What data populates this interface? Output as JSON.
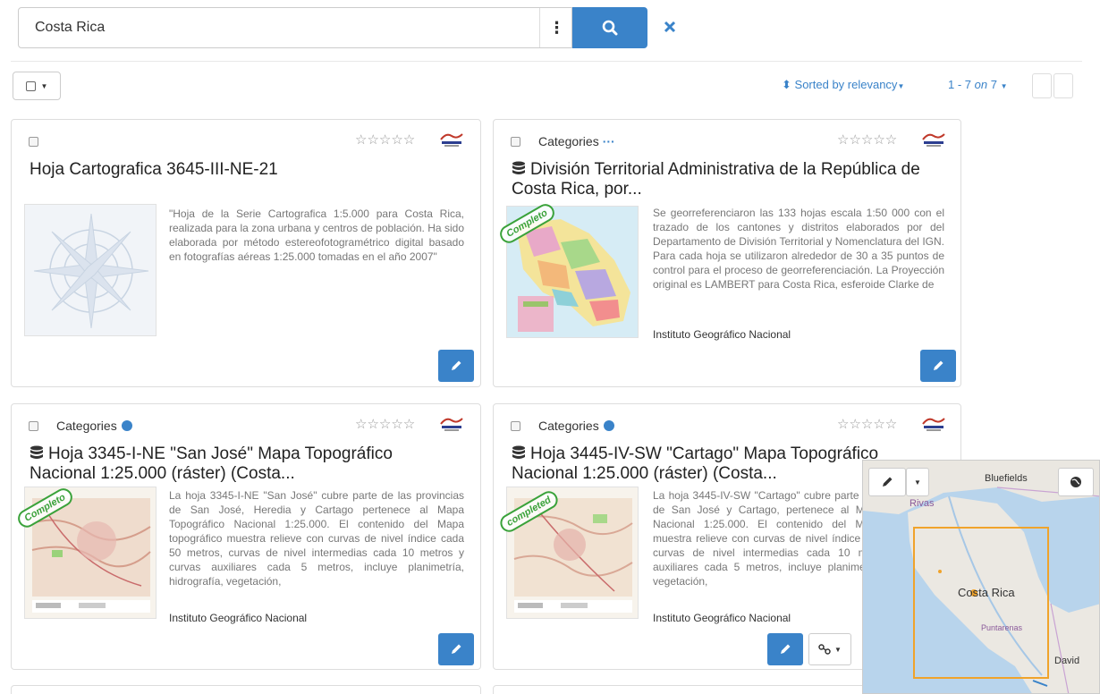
{
  "search": {
    "value": "Costa Rica",
    "options_icon": "⋮"
  },
  "toolbar": {
    "sort_label": "Sorted by relevancy",
    "paging_range": "1 - 7",
    "paging_on": "on",
    "paging_total": "7"
  },
  "cards": [
    {
      "title": "Hoja Cartografica 3645-III-NE-21",
      "category": "",
      "description": "\"Hoja de la Serie Cartografica 1:5.000 para Costa Rica, realizada para la zona urbana y centros de población. Ha sido elaborada por método estereofotogramétrico digital basado en fotografías aéreas 1:25.000 tomadas en el año 2007\"",
      "organization": "",
      "badge": ""
    },
    {
      "title": "División Territorial Administrativa de la República de Costa Rica, por...",
      "category": "Categories",
      "description": "Se georreferenciaron las 133 hojas escala 1:50 000 con el trazado de los cantones y distritos elaborados por del Departamento de División Territorial y Nomenclatura del IGN. Para cada hoja se utilizaron alrededor de 30 a 35 puntos de control para el proceso de georreferenciación. La Proyección original es LAMBERT para Costa Rica, esferoide Clarke de",
      "organization": "Instituto Geográfico Nacional",
      "badge": "Completo"
    },
    {
      "title": "Hoja 3345-I-NE \"San José\" Mapa Topográfico Nacional 1:25.000 (ráster) (Costa...",
      "category": "Categories",
      "description": "La hoja 3345-I-NE \"San José\" cubre parte de las provincias de San José, Heredia y Cartago pertenece al Mapa Topográfico Nacional 1:25.000. El contenido del Mapa topográfico muestra relieve con curvas de nivel índice cada 50 metros, curvas de nivel intermedias cada 10 metros y curvas auxiliares cada 5 metros, incluye planimetría, hidrografía, vegetación,",
      "organization": "Instituto Geográfico Nacional",
      "badge": "Completo"
    },
    {
      "title": "Hoja 3445-IV-SW \"Cartago\" Mapa Topográfico Nacional 1:25.000 (ráster) (Costa...",
      "category": "Categories",
      "description": "La hoja 3445-IV-SW \"Cartago\" cubre parte de las provincias de San José y Cartago, pertenece al Mapa Topográfico Nacional 1:25.000. El contenido del Mapa topográfico muestra relieve con curvas de nivel índice cada 50 metros, curvas de nivel intermedias cada 10 metros y curvas auxiliares cada 5 metros, incluye planimetría, hidrografía, vegetación,",
      "organization": "Instituto Geográfico Nacional",
      "badge": "completed"
    }
  ],
  "map": {
    "labels": {
      "bluefields": "Bluefields",
      "rivas": "Rivas",
      "costa_rica": "Costa Rica",
      "puntarenas": "Puntarenas",
      "david": "David"
    }
  },
  "colors": {
    "primary": "#3a83c9",
    "badge_green": "#3aa23a",
    "bbox_orange": "#f0a32b"
  }
}
